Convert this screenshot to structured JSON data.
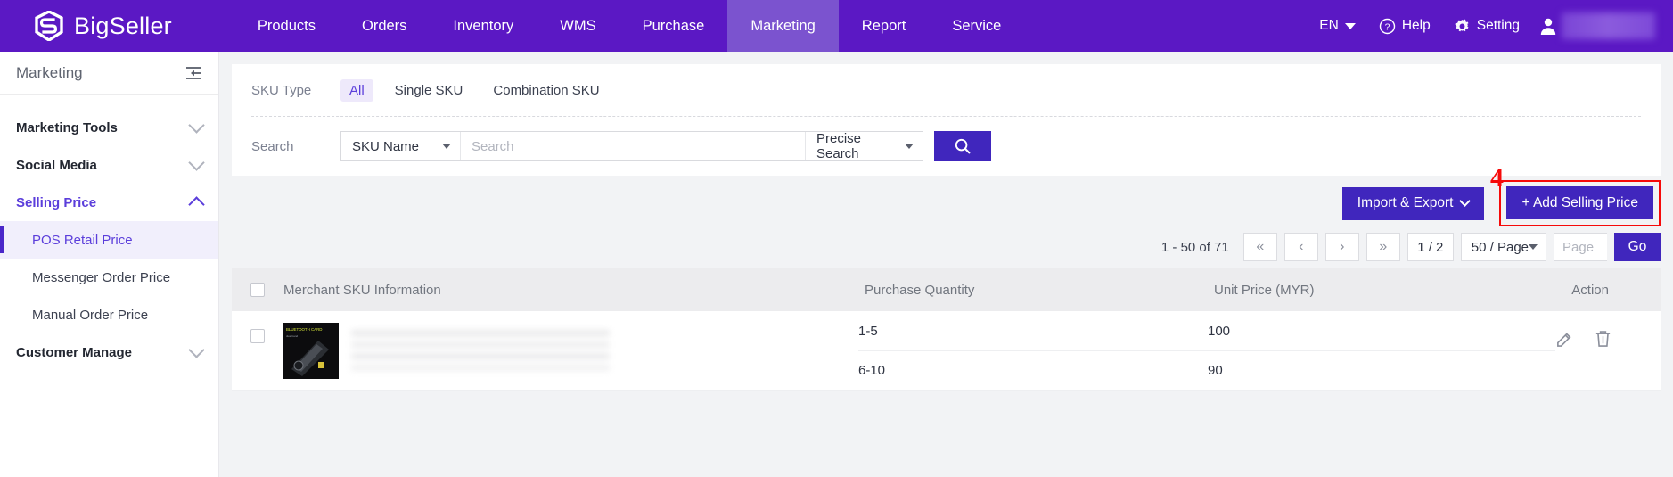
{
  "brand": {
    "name": "BigSeller",
    "logo_icon": "bigseller-logo-icon"
  },
  "topnav": {
    "items": [
      {
        "label": "Products",
        "active": false
      },
      {
        "label": "Orders",
        "active": false
      },
      {
        "label": "Inventory",
        "active": false
      },
      {
        "label": "WMS",
        "active": false
      },
      {
        "label": "Purchase",
        "active": false
      },
      {
        "label": "Marketing",
        "active": true
      },
      {
        "label": "Report",
        "active": false
      },
      {
        "label": "Service",
        "active": false
      }
    ],
    "language": "EN",
    "help": "Help",
    "setting": "Setting",
    "help_icon": "question-circle-icon",
    "setting_icon": "gear-icon",
    "avatar_icon": "user-avatar-icon"
  },
  "sidebar": {
    "title": "Marketing",
    "collapse_icon": "collapse-panel-icon",
    "groups": [
      {
        "label": "Marketing Tools",
        "expanded": false
      },
      {
        "label": "Social Media",
        "expanded": false
      },
      {
        "label": "Selling Price",
        "expanded": true
      }
    ],
    "sub_items": [
      {
        "label": "POS Retail Price",
        "active": true
      },
      {
        "label": "Messenger Order Price",
        "active": false
      },
      {
        "label": "Manual Order Price",
        "active": false
      }
    ],
    "last_group": {
      "label": "Customer Manage",
      "expanded": false
    }
  },
  "filters": {
    "sku_type_label": "SKU Type",
    "sku_type_options": [
      {
        "label": "All",
        "selected": true
      },
      {
        "label": "Single SKU",
        "selected": false
      },
      {
        "label": "Combination SKU",
        "selected": false
      }
    ],
    "search_label": "Search",
    "field_select": "SKU Name",
    "search_placeholder": "Search",
    "search_value": "",
    "match_select": "Precise Search",
    "search_button_icon": "search-icon"
  },
  "toolbar": {
    "import_export": "Import & Export",
    "add_selling_price": "+ Add Selling Price",
    "annotation_number": "4",
    "annotation_color": "#f60a0a"
  },
  "pagination": {
    "range_text": "1 - 50 of 71",
    "first_icon": "«",
    "prev_icon": "‹",
    "next_icon": "›",
    "last_icon": "»",
    "page_indicator": "1 / 2",
    "page_size": "50 / Page",
    "page_input_placeholder": "Page",
    "page_input_value": "",
    "go_label": "Go"
  },
  "table": {
    "columns": [
      "Merchant SKU Information",
      "Purchase Quantity",
      "Unit Price (MYR)",
      "Action"
    ],
    "rows": [
      {
        "sku_name_blurred": true,
        "thumbnail": "product-thumbnail",
        "tiers": [
          {
            "quantity": "1-5",
            "price": "100"
          },
          {
            "quantity": "6-10",
            "price": "90"
          }
        ],
        "edit_icon": "edit-icon",
        "delete_icon": "trash-icon"
      }
    ]
  },
  "colors": {
    "brand_purple": "#5b18c4",
    "accent_purple": "#4026bd",
    "active_nav": "#7b53cf",
    "annotation_red": "#f60a0a"
  }
}
